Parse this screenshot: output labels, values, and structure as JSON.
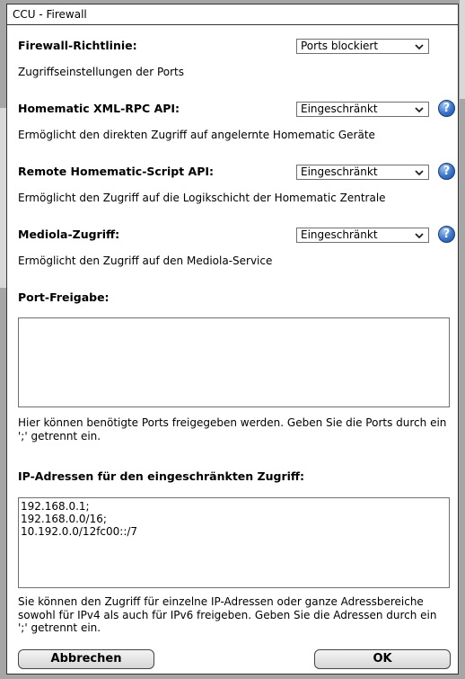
{
  "dialog": {
    "title": "CCU - Firewall"
  },
  "firewall_policy": {
    "label": "Firewall-Richtlinie:",
    "value": "Ports blockiert",
    "description": "Zugriffseinstellungen der Ports"
  },
  "xmlrpc": {
    "label": "Homematic XML-RPC API:",
    "value": "Eingeschränkt",
    "description": "Ermöglicht den direkten Zugriff auf angelernte Homematic Geräte"
  },
  "script_api": {
    "label": "Remote Homematic-Script API:",
    "value": "Eingeschränkt",
    "description": "Ermöglicht den Zugriff auf die Logikschicht der Homematic Zentrale"
  },
  "mediola": {
    "label": "Mediola-Zugriff:",
    "value": "Eingeschränkt",
    "description": "Ermöglicht den Zugriff auf den Mediola-Service"
  },
  "port_release": {
    "label": "Port-Freigabe:",
    "value": "",
    "help": "Hier können benötigte Ports freigegeben werden. Geben Sie die Ports durch ein ';' getrennt ein."
  },
  "ip_access": {
    "label": "IP-Adressen für den eingeschränkten Zugriff:",
    "value": "192.168.0.1;\n192.168.0.0/16;\n10.192.0.0/12fc00::/7",
    "help": "Sie können den Zugriff für einzelne IP-Adressen oder ganze Adressbereiche sowohl für IPv4 als auch für IPv6 freigeben. Geben Sie die Adressen durch ein ';' getrennt ein."
  },
  "help_icon": "?",
  "buttons": {
    "cancel": "Abbrechen",
    "ok": "OK"
  },
  "icons": {
    "help": "help-icon",
    "dropdown": "chevron-down-icon"
  }
}
